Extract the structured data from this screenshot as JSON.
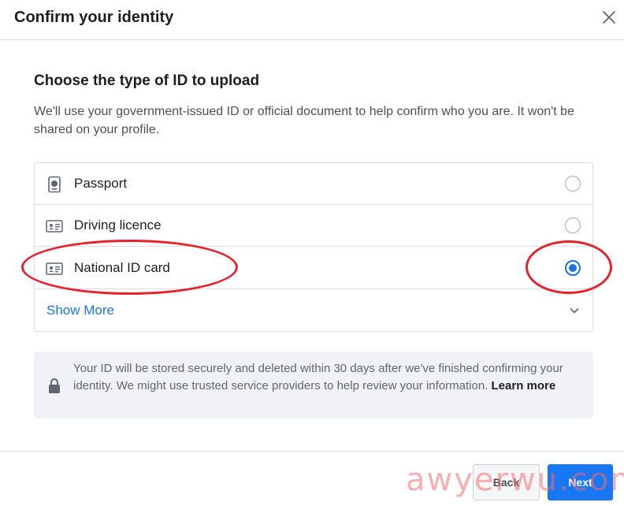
{
  "dialog": {
    "title": "Confirm your identity"
  },
  "section": {
    "title": "Choose the type of ID to upload",
    "description": "We'll use your government-issued ID or official document to help confirm who you are. It won't be shared on your profile."
  },
  "options": [
    {
      "label": "Passport",
      "icon": "passport-icon",
      "selected": false
    },
    {
      "label": "Driving licence",
      "icon": "id-card-icon",
      "selected": false
    },
    {
      "label": "National ID card",
      "icon": "id-card-icon",
      "selected": true
    }
  ],
  "show_more": {
    "label": "Show More",
    "icon": "chevron-down-icon"
  },
  "info": {
    "text": "Your ID will be stored securely and deleted within 30 days after we've finished confirming your identity. We might use trusted service providers to help review your information.",
    "link": "Learn more",
    "icon": "lock-icon"
  },
  "footer": {
    "back_label": "Back",
    "next_label": "Next"
  },
  "watermark": {
    "text": "awyerwu.com"
  },
  "colors": {
    "accent": "#1877f2",
    "radio_selected": "#1b74e4",
    "annotation": "#e8222d",
    "info_bg": "#f0f2f5"
  }
}
